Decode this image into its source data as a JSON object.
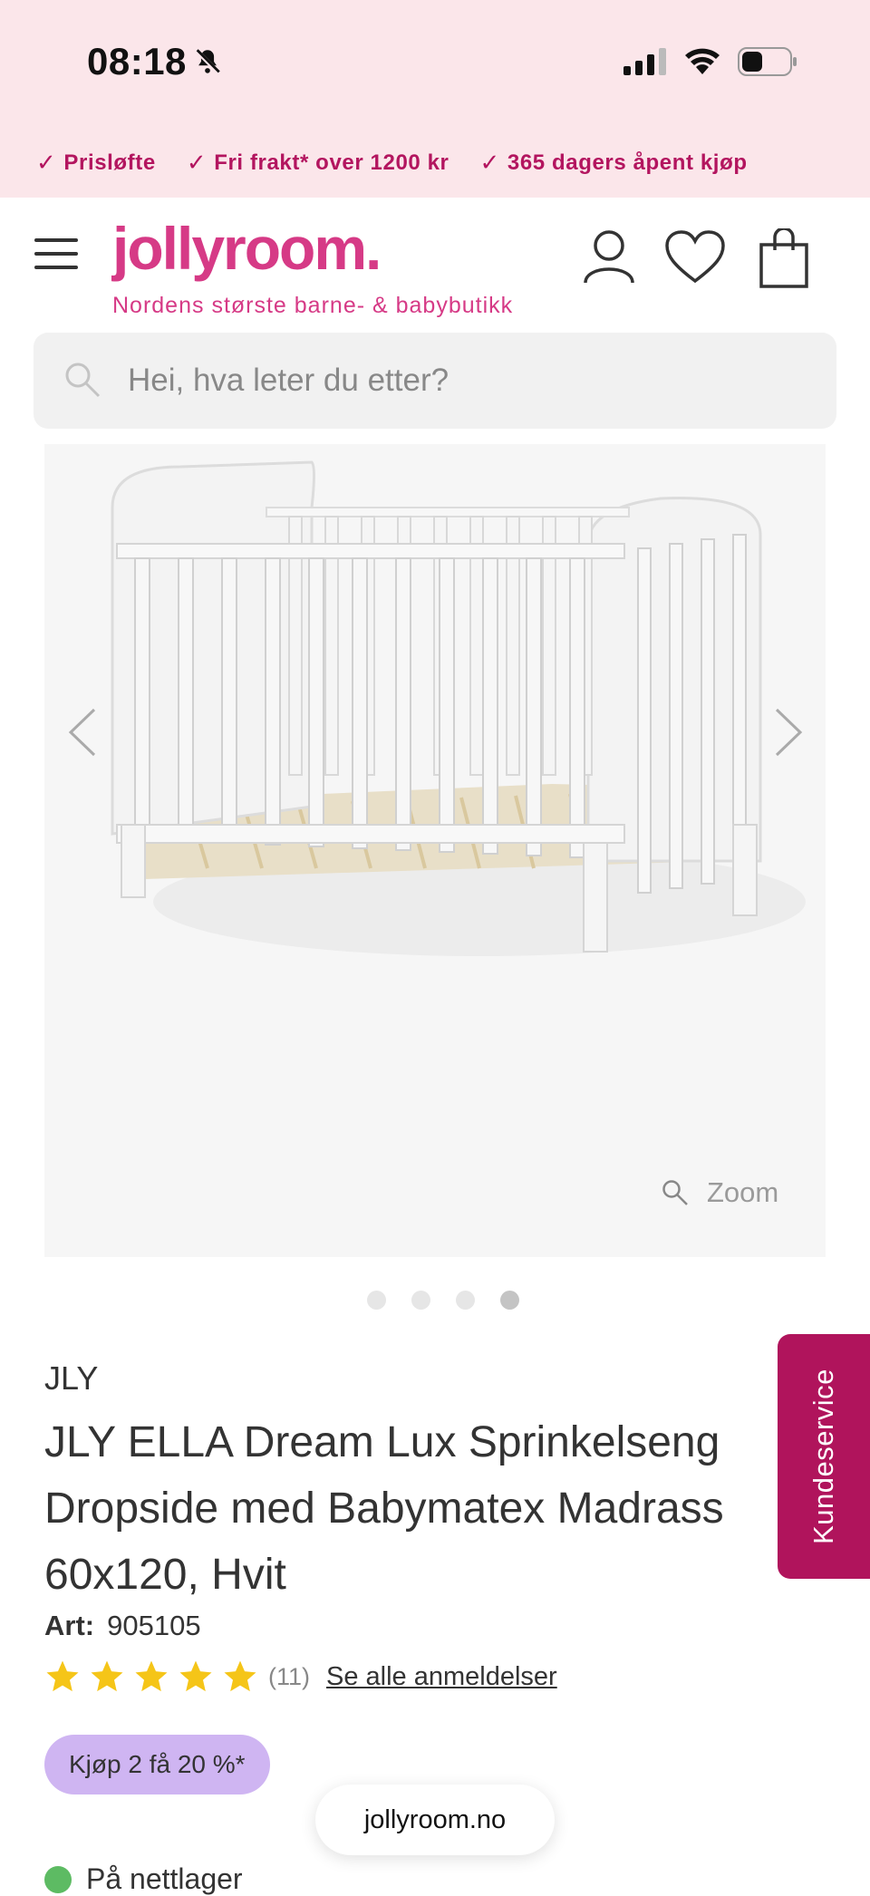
{
  "status_bar": {
    "time": "08:18",
    "icons": [
      "bell-slash-icon",
      "signal-icon",
      "wifi-icon",
      "battery-icon"
    ]
  },
  "usps": [
    {
      "label": "Prisløfte"
    },
    {
      "label": "Fri frakt* over 1200 kr"
    },
    {
      "label": "365 dagers åpent kjøp"
    }
  ],
  "header": {
    "logo": "jollyroom.",
    "tagline": "Nordens største barne- & babybutikk",
    "icons": [
      "menu-icon",
      "account-icon",
      "wishlist-heart-icon",
      "cart-bag-icon"
    ]
  },
  "search": {
    "placeholder": "Hei, hva leter du etter?"
  },
  "gallery": {
    "zoom_label": "Zoom",
    "image_count": 4,
    "active_index": 3
  },
  "product": {
    "brand": "JLY",
    "title_lines": [
      "JLY ELLA Dream Lux Sprinkelseng",
      "Dropside med Babymatex Madrass",
      "60x120, Hvit"
    ],
    "art_label": "Art:",
    "art_number": "905105",
    "rating_stars": 5,
    "review_count": "(11)",
    "see_all_reviews": "Se alle anmeldelser",
    "promo": "Kjøp 2 få 20 %*",
    "stock": "På nettlager"
  },
  "customer_service": "Kundeservice",
  "browser": {
    "url": "jollyroom.no"
  },
  "colors": {
    "brand_pink": "#d63a86",
    "usp_pink": "#b3155f",
    "top_bg": "#fbe6ea",
    "kundeservice_bg": "#b0145c",
    "promo_bg": "#cfb5f2",
    "star": "#f5c518",
    "stock_green": "#5dbb63"
  }
}
